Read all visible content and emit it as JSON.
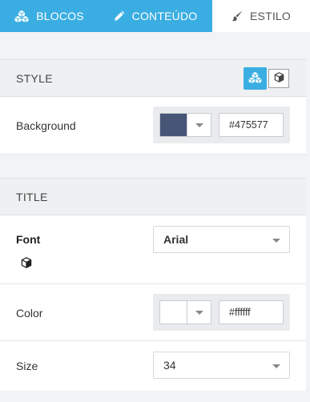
{
  "tabs": [
    {
      "label": "BLOCOS",
      "icon": "cubes-icon"
    },
    {
      "label": "CONTEÚDO",
      "icon": "pencil-icon"
    },
    {
      "label": "ESTILO",
      "icon": "paintbrush-icon"
    }
  ],
  "style_section": {
    "title": "STYLE",
    "toggle": {
      "active": "cubes-icon",
      "inactive": "cube-icon"
    },
    "background": {
      "label": "Background",
      "color": "#475577",
      "hex_value": "#475577"
    }
  },
  "title_section": {
    "title": "TITLE",
    "font": {
      "label": "Font",
      "value": "Arial",
      "icon": "cube-icon"
    },
    "color": {
      "label": "Color",
      "color": "#ffffff",
      "hex_value": "#ffffff"
    },
    "size": {
      "label": "Size",
      "value": "34"
    }
  },
  "colors": {
    "accent": "#3aaee2",
    "swatch_background": "#475577",
    "swatch_title": "#ffffff"
  }
}
